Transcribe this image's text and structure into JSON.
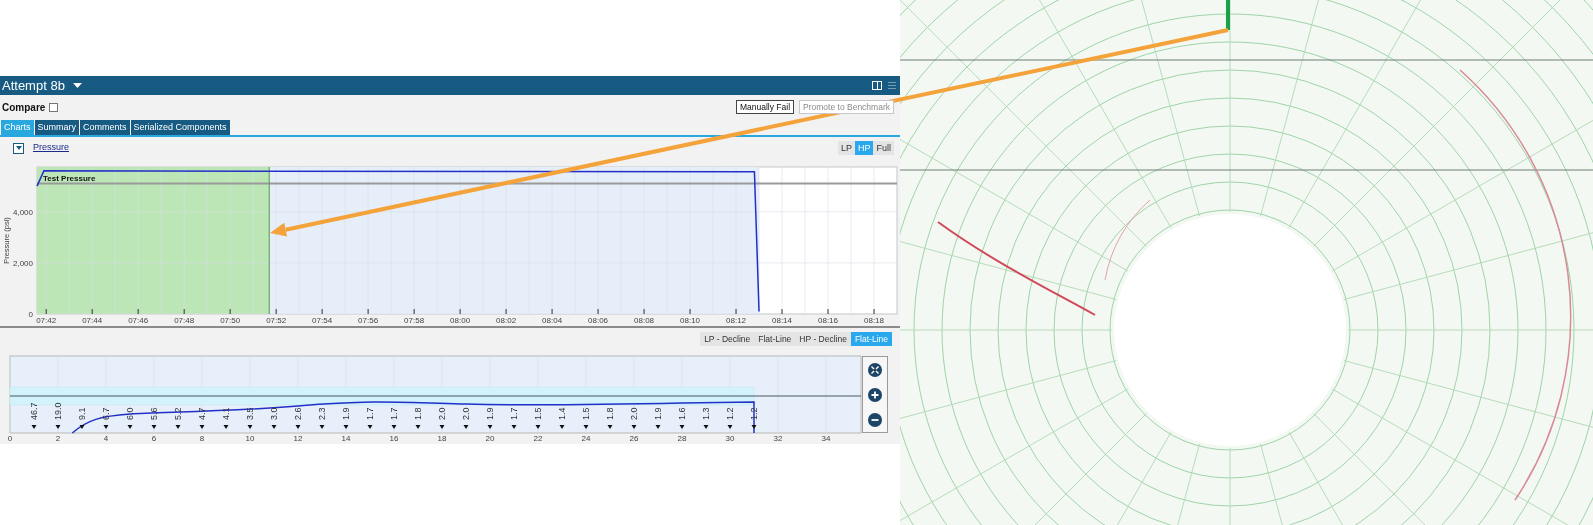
{
  "header": {
    "title": "Attempt 8b"
  },
  "compare": {
    "label": "Compare",
    "checked": false
  },
  "actions": [
    {
      "label": "Manually Fail",
      "disabled": false
    },
    {
      "label": "Promote to Benchmark",
      "disabled": true
    }
  ],
  "tabs": [
    {
      "label": "Charts",
      "selected": true
    },
    {
      "label": "Summary",
      "selected": false
    },
    {
      "label": "Comments",
      "selected": false
    },
    {
      "label": "Serialized Components",
      "selected": false
    }
  ],
  "pressure_panel": {
    "ranges": [
      {
        "label": "LP",
        "selected": false
      },
      {
        "label": "HP",
        "selected": true
      },
      {
        "label": "Full",
        "selected": false
      }
    ],
    "chart_data": {
      "type": "line",
      "ylabel": "Pressure (psi)",
      "grid": true,
      "xlim": [
        461.6,
        499
      ],
      "ylim": [
        0,
        5750
      ],
      "bands": [
        {
          "axis": "x",
          "from": 461.6,
          "to": 471.7,
          "color": "#bde6b6"
        },
        {
          "axis": "x",
          "from": 471.7,
          "to": 493.0,
          "color": "#e6eff9"
        }
      ],
      "ref_lines": [
        {
          "axis": "y",
          "value": 5100,
          "label": "Test Pressure",
          "color": "#9a9a9a"
        },
        {
          "axis": "x",
          "value": 471.7,
          "color": "#4d9a4d"
        }
      ],
      "xticks": [
        {
          "value": 462,
          "label": "07:42"
        },
        {
          "value": 464,
          "label": "07:44"
        },
        {
          "value": 466,
          "label": "07:46"
        },
        {
          "value": 468,
          "label": "07:48"
        },
        {
          "value": 470,
          "label": "07:50"
        },
        {
          "value": 472,
          "label": "07:52"
        },
        {
          "value": 474,
          "label": "07:54"
        },
        {
          "value": 476,
          "label": "07:56"
        },
        {
          "value": 478,
          "label": "07:58"
        },
        {
          "value": 480,
          "label": "08:00"
        },
        {
          "value": 482,
          "label": "08:02"
        },
        {
          "value": 484,
          "label": "08:04"
        },
        {
          "value": 486,
          "label": "08:06"
        },
        {
          "value": 488,
          "label": "08:08"
        },
        {
          "value": 490,
          "label": "08:10"
        },
        {
          "value": 492,
          "label": "08:12"
        },
        {
          "value": 494,
          "label": "08:14"
        },
        {
          "value": 496,
          "label": "08:16"
        },
        {
          "value": 498,
          "label": "08:18"
        }
      ],
      "yticks": [
        {
          "value": 0,
          "label": "0"
        },
        {
          "value": 2000,
          "label": "2,000"
        },
        {
          "value": 4000,
          "label": "4,000"
        }
      ],
      "x": [
        461.6,
        461.9,
        492.8,
        493.0
      ],
      "series": [
        {
          "name": "Pressure",
          "color": "#2330c8",
          "values": [
            5000,
            5600,
            5560,
            100
          ]
        }
      ]
    }
  },
  "analysis_panel": {
    "modes": [
      {
        "label": "LP - Decline",
        "selected": false
      },
      {
        "label": "Flat-Line",
        "selected": false
      },
      {
        "label": "HP - Decline",
        "selected": false
      },
      {
        "label": "Flat-Line",
        "selected": true
      }
    ],
    "x_ticks": [
      "0",
      "2",
      "4",
      "6",
      "8",
      "10",
      "12",
      "14",
      "16",
      "18",
      "20",
      "22",
      "24",
      "26",
      "28",
      "30",
      "32",
      "34"
    ],
    "markers": [
      "46.7",
      "19.0",
      "9.1",
      "6.7",
      "6.0",
      "5.6",
      "5.2",
      "4.7",
      "4.1",
      "3.5",
      "3.0",
      "2.6",
      "2.3",
      "1.9",
      "1.7",
      "1.7",
      "1.8",
      "2.0",
      "2.0",
      "1.9",
      "1.7",
      "1.5",
      "1.4",
      "1.5",
      "1.8",
      "2.0",
      "1.9",
      "1.6",
      "1.3",
      "1.2",
      "1.2"
    ]
  }
}
